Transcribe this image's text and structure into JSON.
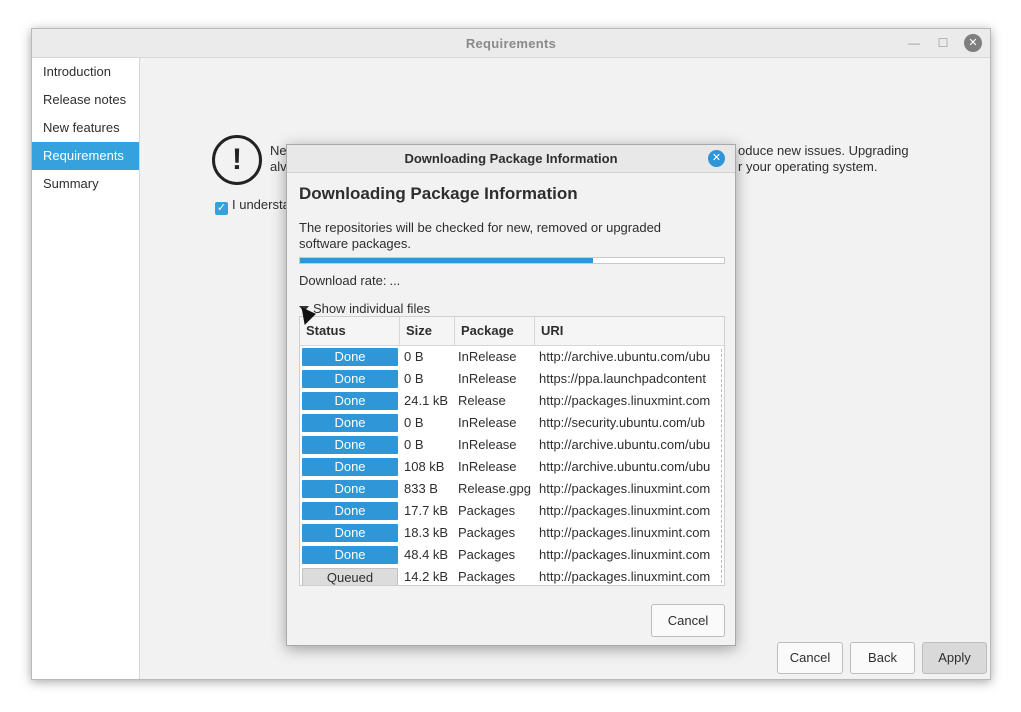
{
  "window": {
    "title": "Requirements",
    "minimize_glyph": "—",
    "maximize_glyph": "☐",
    "close_glyph": "✕"
  },
  "sidebar": {
    "items": [
      {
        "label": "Introduction"
      },
      {
        "label": "Release notes"
      },
      {
        "label": "New features"
      },
      {
        "label": "Requirements",
        "active": true
      },
      {
        "label": "Summary"
      }
    ]
  },
  "main": {
    "warning_icon_glyph": "!",
    "warning_left_line1": "Ne",
    "warning_left_line2": "alv",
    "warning_right_line1": "oduce new issues. Upgrading",
    "warning_right_line2": "r your operating system.",
    "understand_label": "I understa",
    "checkbox_glyph": "✓"
  },
  "footer": {
    "cancel_label": "Cancel",
    "back_label": "Back",
    "apply_label": "Apply"
  },
  "dialog": {
    "title": "Downloading Package Information",
    "close_glyph": "✕",
    "heading": "Downloading Package Information",
    "description": "The repositories will be checked for new, removed or upgraded software packages.",
    "progress_fraction": 0.69,
    "download_rate_label": "Download rate:",
    "download_rate_value": "...",
    "show_files_label": "Show individual files",
    "cancel_label": "Cancel",
    "table": {
      "headers": [
        "Status",
        "Size",
        "Package",
        "URI"
      ],
      "rows": [
        {
          "status": "Done",
          "size": "0  B",
          "package": "InRelease",
          "uri": "http://archive.ubuntu.com/ubu"
        },
        {
          "status": "Done",
          "size": "0  B",
          "package": "InRelease",
          "uri": "https://ppa.launchpadcontent"
        },
        {
          "status": "Done",
          "size": "24.1 kB",
          "package": "Release",
          "uri": "http://packages.linuxmint.com"
        },
        {
          "status": "Done",
          "size": "0  B",
          "package": "InRelease",
          "uri": "http://security.ubuntu.com/ub"
        },
        {
          "status": "Done",
          "size": "0  B",
          "package": "InRelease",
          "uri": "http://archive.ubuntu.com/ubu"
        },
        {
          "status": "Done",
          "size": "108 kB",
          "package": "InRelease",
          "uri": "http://archive.ubuntu.com/ubu"
        },
        {
          "status": "Done",
          "size": "833  B",
          "package": "Release.gpg",
          "uri": "http://packages.linuxmint.com"
        },
        {
          "status": "Done",
          "size": "17.7 kB",
          "package": "Packages",
          "uri": "http://packages.linuxmint.com"
        },
        {
          "status": "Done",
          "size": "18.3 kB",
          "package": "Packages",
          "uri": "http://packages.linuxmint.com"
        },
        {
          "status": "Done",
          "size": "48.4 kB",
          "package": "Packages",
          "uri": "http://packages.linuxmint.com"
        },
        {
          "status": "Queued",
          "size": "14.2 kB",
          "package": "Packages",
          "uri": "http://packages.linuxmint.com"
        }
      ]
    }
  },
  "colors": {
    "accent": "#35a2dd",
    "progress": "#2f97d8"
  }
}
